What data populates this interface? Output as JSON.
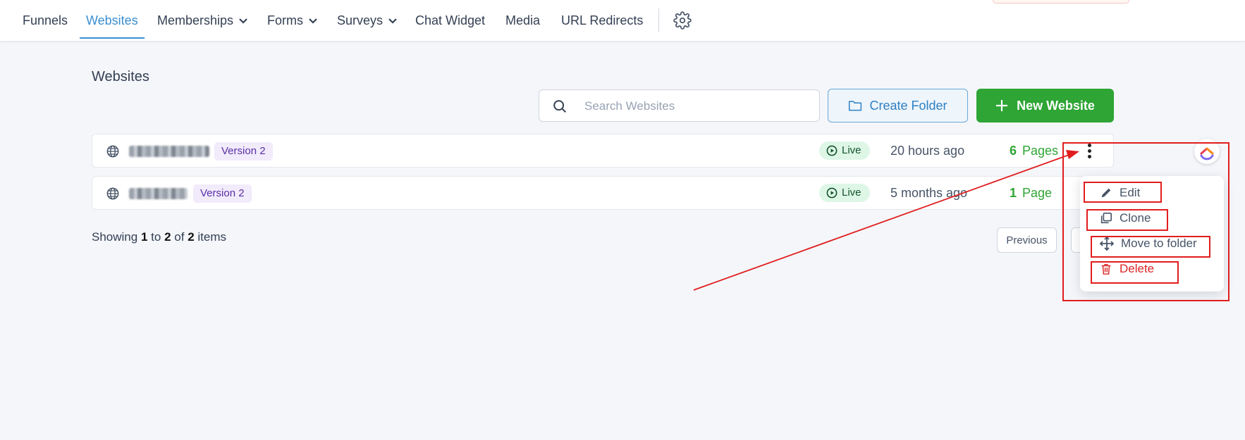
{
  "nav": {
    "items": [
      {
        "label": "Funnels"
      },
      {
        "label": "Websites"
      },
      {
        "label": "Memberships"
      },
      {
        "label": "Forms"
      },
      {
        "label": "Surveys"
      },
      {
        "label": "Chat Widget"
      },
      {
        "label": "Media"
      },
      {
        "label": "URL Redirects"
      }
    ],
    "active": "Websites"
  },
  "page": {
    "title": "Websites"
  },
  "search": {
    "placeholder": "Search Websites",
    "value": ""
  },
  "toolbar": {
    "create_folder_label": "Create Folder",
    "new_website_label": "New Website"
  },
  "rows": [
    {
      "version": "Version 2",
      "status": "Live",
      "updated": "20 hours ago",
      "page_count": "6",
      "page_label": "Pages"
    },
    {
      "version": "Version 2",
      "status": "Live",
      "updated": "5 months ago",
      "page_count": "1",
      "page_label": "Page"
    }
  ],
  "pagination": {
    "prefix": "Showing",
    "from": "1",
    "to_word": "to",
    "to": "2",
    "of_word": "of",
    "total": "2",
    "suffix": "items",
    "previous_label": "Previous"
  },
  "context_menu": {
    "edit": "Edit",
    "clone": "Clone",
    "move": "Move to folder",
    "delete": "Delete"
  },
  "colors": {
    "accent": "#3b8fd0",
    "primary_green": "#2ea534",
    "danger": "#dc2626",
    "annotation_red": "#e11d1d"
  }
}
